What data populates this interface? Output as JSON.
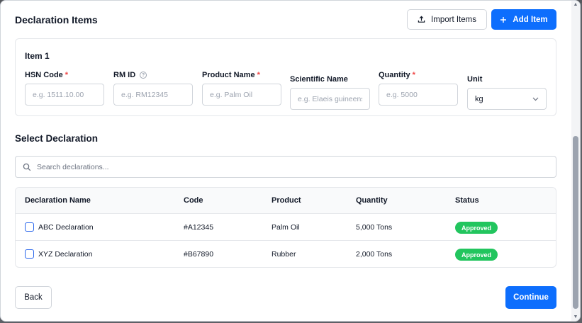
{
  "header": {
    "title": "Declaration Items",
    "import_label": "Import Items",
    "add_label": "Add Item"
  },
  "item": {
    "title": "Item 1",
    "fields": [
      {
        "label": "HSN Code",
        "required": true,
        "placeholder": "e.g. 1511.10.00"
      },
      {
        "label": "RM ID",
        "help": true,
        "placeholder": "e.g. RM12345"
      },
      {
        "label": "Product Name",
        "required": true,
        "placeholder": "e.g. Palm Oil"
      },
      {
        "label": "Scientific Name",
        "placeholder": "e.g. Elaeis guineensis"
      },
      {
        "label": "Quantity",
        "required": true,
        "placeholder": "e.g. 5000"
      },
      {
        "label": "Unit",
        "value": "kg"
      }
    ],
    "required_mark": "*",
    "help_glyph": "?"
  },
  "select_declaration": {
    "title": "Select Declaration",
    "search_placeholder": "Search declarations..."
  },
  "table": {
    "columns": [
      "Declaration Name",
      "Code",
      "Product",
      "Quantity",
      "Status"
    ],
    "rows": [
      {
        "name": "ABC Declaration",
        "code": "#A12345",
        "product": "Palm Oil",
        "quantity": "5,000 Tons",
        "status": "Approved",
        "checked": false
      },
      {
        "name": "XYZ Declaration",
        "code": "#B67890",
        "product": "Rubber",
        "quantity": "2,000 Tons",
        "status": "Approved",
        "checked": false
      }
    ]
  },
  "footer": {
    "back_label": "Back",
    "continue_label": "Continue"
  },
  "colors": {
    "primary": "#0d6efd",
    "status_approved": "#22c55e",
    "required": "#ef4444"
  },
  "icons": {
    "import": "upload-icon",
    "add": "plus-icon",
    "search": "search-icon",
    "unit_dropdown": "chevron-down-icon",
    "help": "help-circle-icon"
  }
}
